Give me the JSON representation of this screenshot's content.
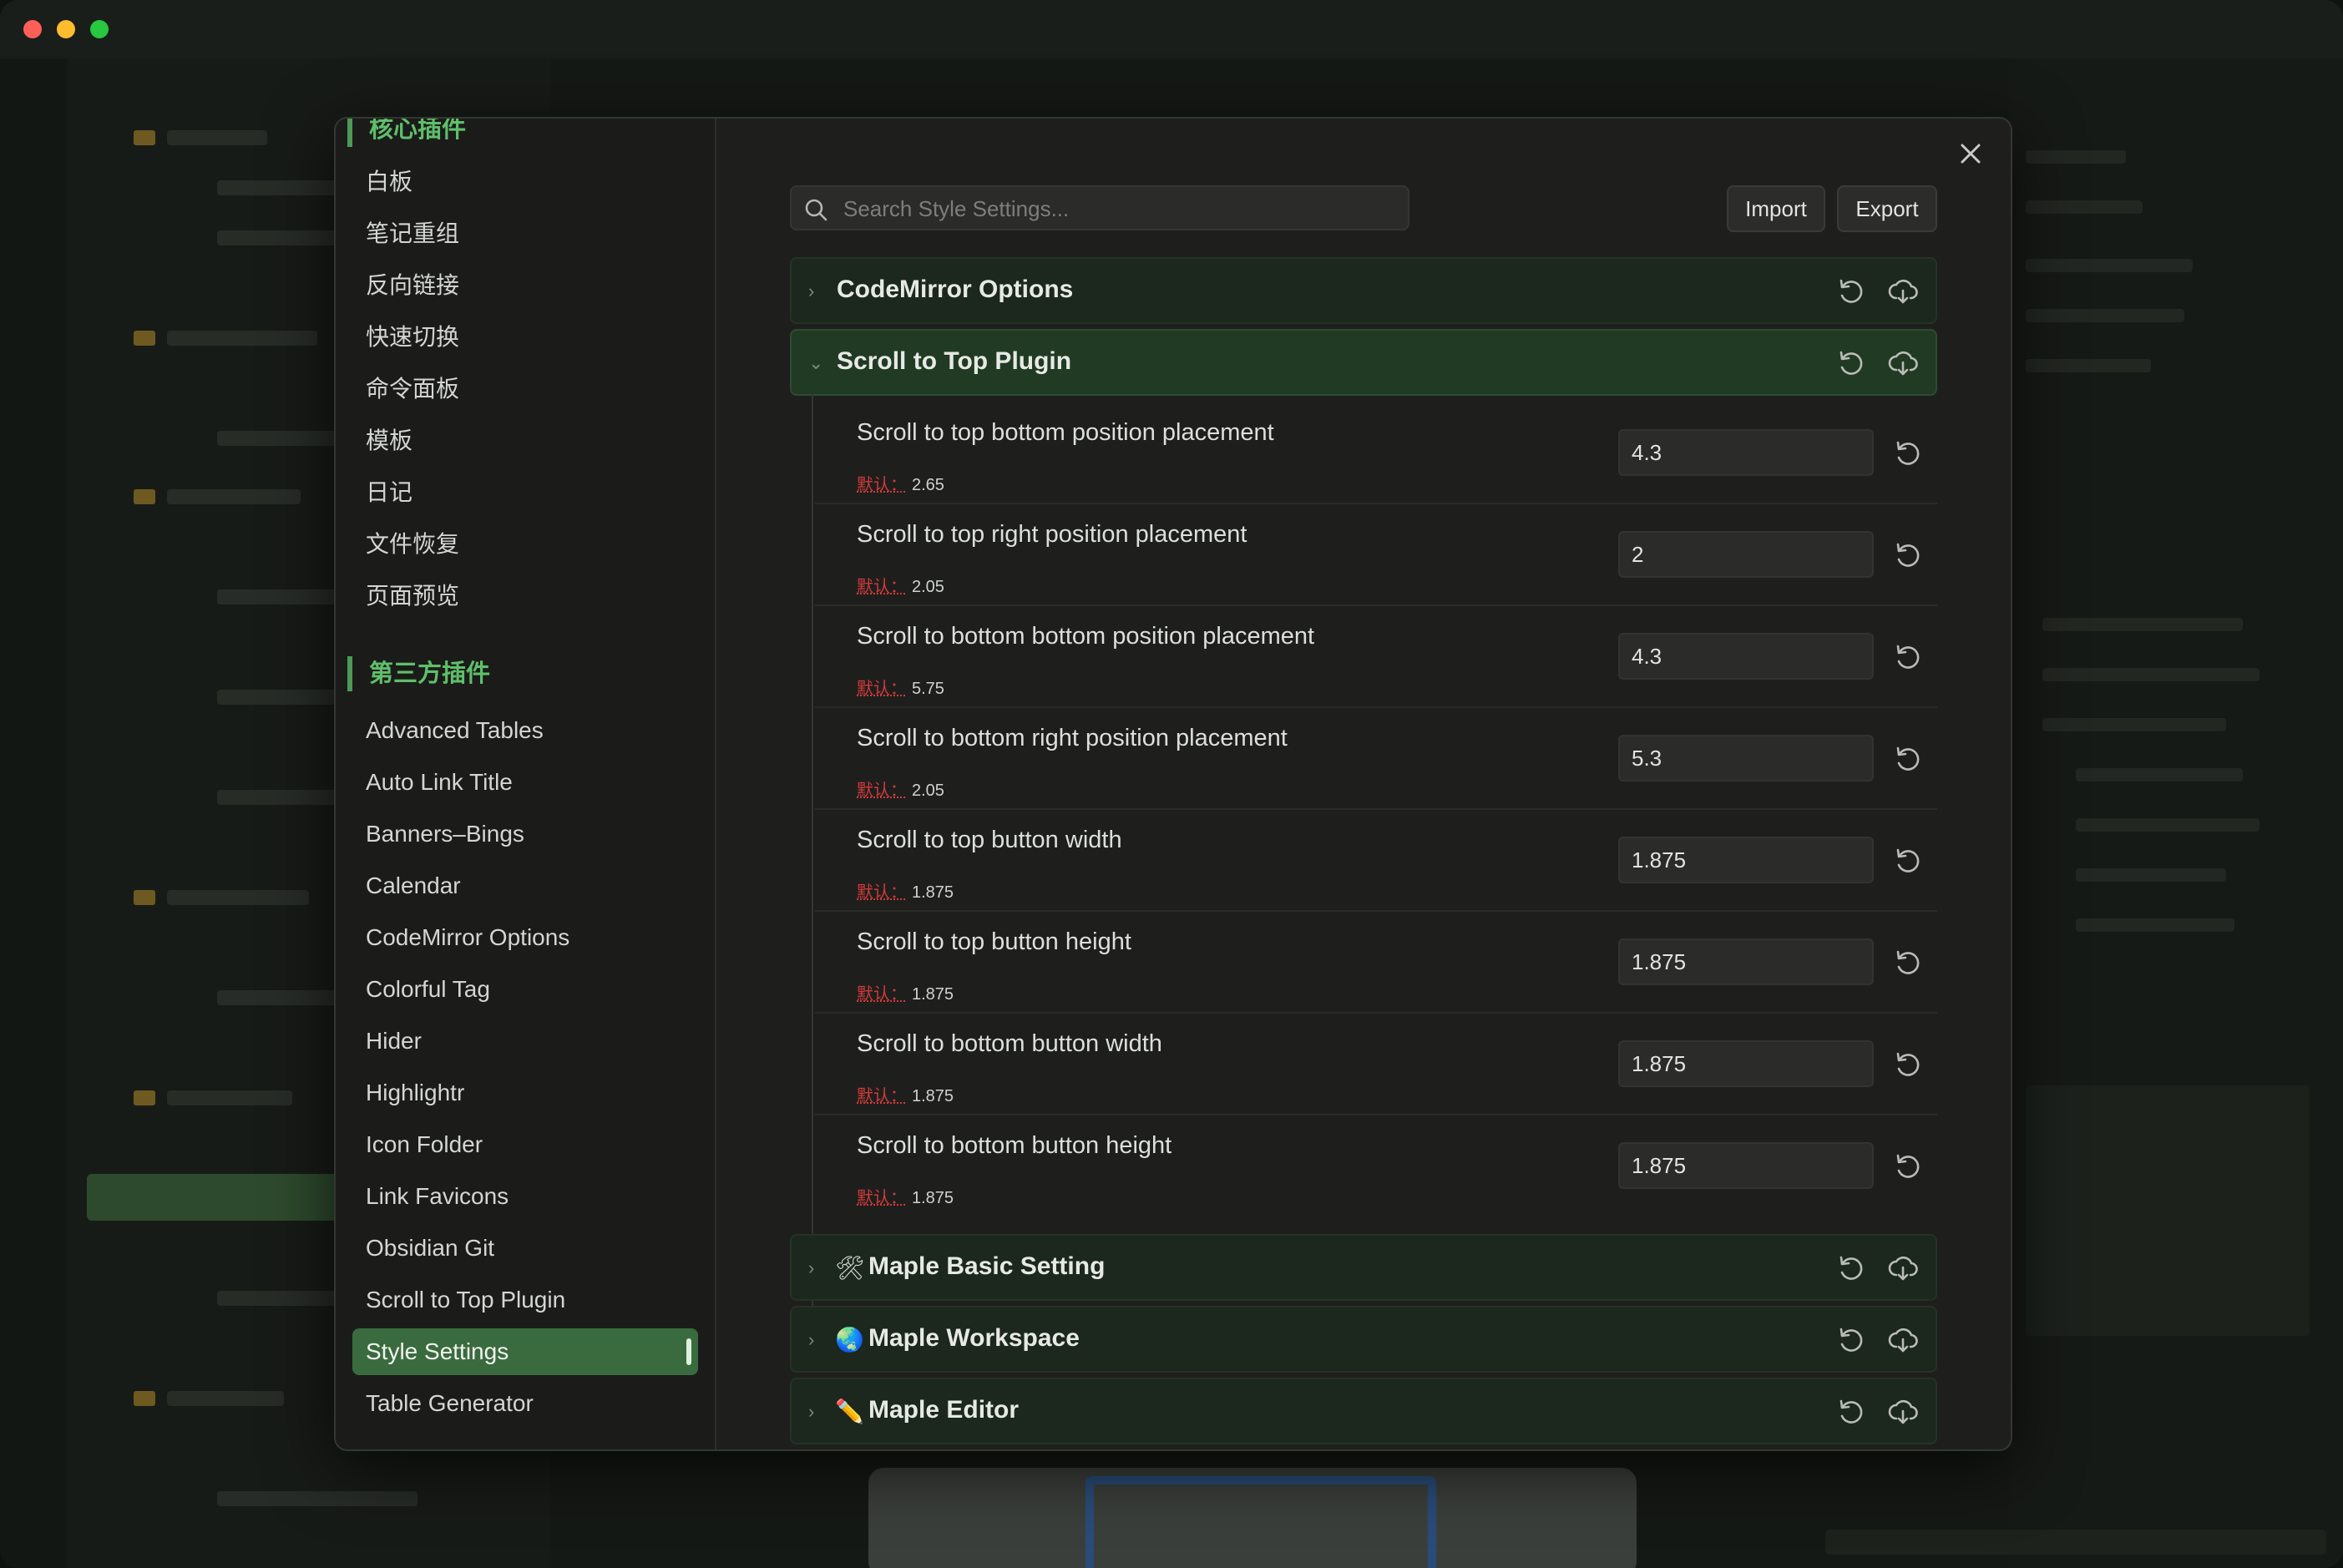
{
  "background": {
    "accent_colors": {
      "primary": "#4c9a56",
      "active_bg": "#3a6b3e",
      "default_label": "#d23a3a"
    }
  },
  "sidebar": {
    "core_heading": "核心插件",
    "core_items": [
      "白板",
      "笔记重组",
      "反向链接",
      "快速切换",
      "命令面板",
      "模板",
      "日记",
      "文件恢复",
      "页面预览"
    ],
    "third_heading": "第三方插件",
    "third_items": [
      "Advanced Tables",
      "Auto Link Title",
      "Banners–Bings",
      "Calendar",
      "CodeMirror Options",
      "Colorful Tag",
      "Hider",
      "Highlightr",
      "Icon Folder",
      "Link Favicons",
      "Obsidian Git",
      "Scroll to Top Plugin",
      "Style Settings",
      "Table Generator"
    ],
    "active_item": "Style Settings"
  },
  "toolbar": {
    "search_placeholder": "Search Style Settings...",
    "import_label": "Import",
    "export_label": "Export"
  },
  "groups": [
    {
      "title": "CodeMirror Options",
      "emoji": "",
      "expanded": false
    },
    {
      "title": "Scroll to Top Plugin",
      "emoji": "",
      "expanded": true
    },
    {
      "title": "Maple Basic Setting",
      "emoji": "🛠",
      "expanded": false
    },
    {
      "title": "Maple Workspace",
      "emoji": "🌏",
      "expanded": false
    },
    {
      "title": "Maple Editor",
      "emoji": "✏️",
      "expanded": false
    }
  ],
  "default_label": "默认：",
  "settings": [
    {
      "name": "Scroll to top bottom position placement",
      "default": "2.65",
      "value": "4.3"
    },
    {
      "name": "Scroll to top right position placement",
      "default": "2.05",
      "value": "2"
    },
    {
      "name": "Scroll to bottom bottom position placement",
      "default": "5.75",
      "value": "4.3"
    },
    {
      "name": "Scroll to bottom right position placement",
      "default": "2.05",
      "value": "5.3"
    },
    {
      "name": "Scroll to top button width",
      "default": "1.875",
      "value": "1.875"
    },
    {
      "name": "Scroll to top button height",
      "default": "1.875",
      "value": "1.875"
    },
    {
      "name": "Scroll to bottom button width",
      "default": "1.875",
      "value": "1.875"
    },
    {
      "name": "Scroll to bottom button height",
      "default": "1.875",
      "value": "1.875"
    }
  ]
}
